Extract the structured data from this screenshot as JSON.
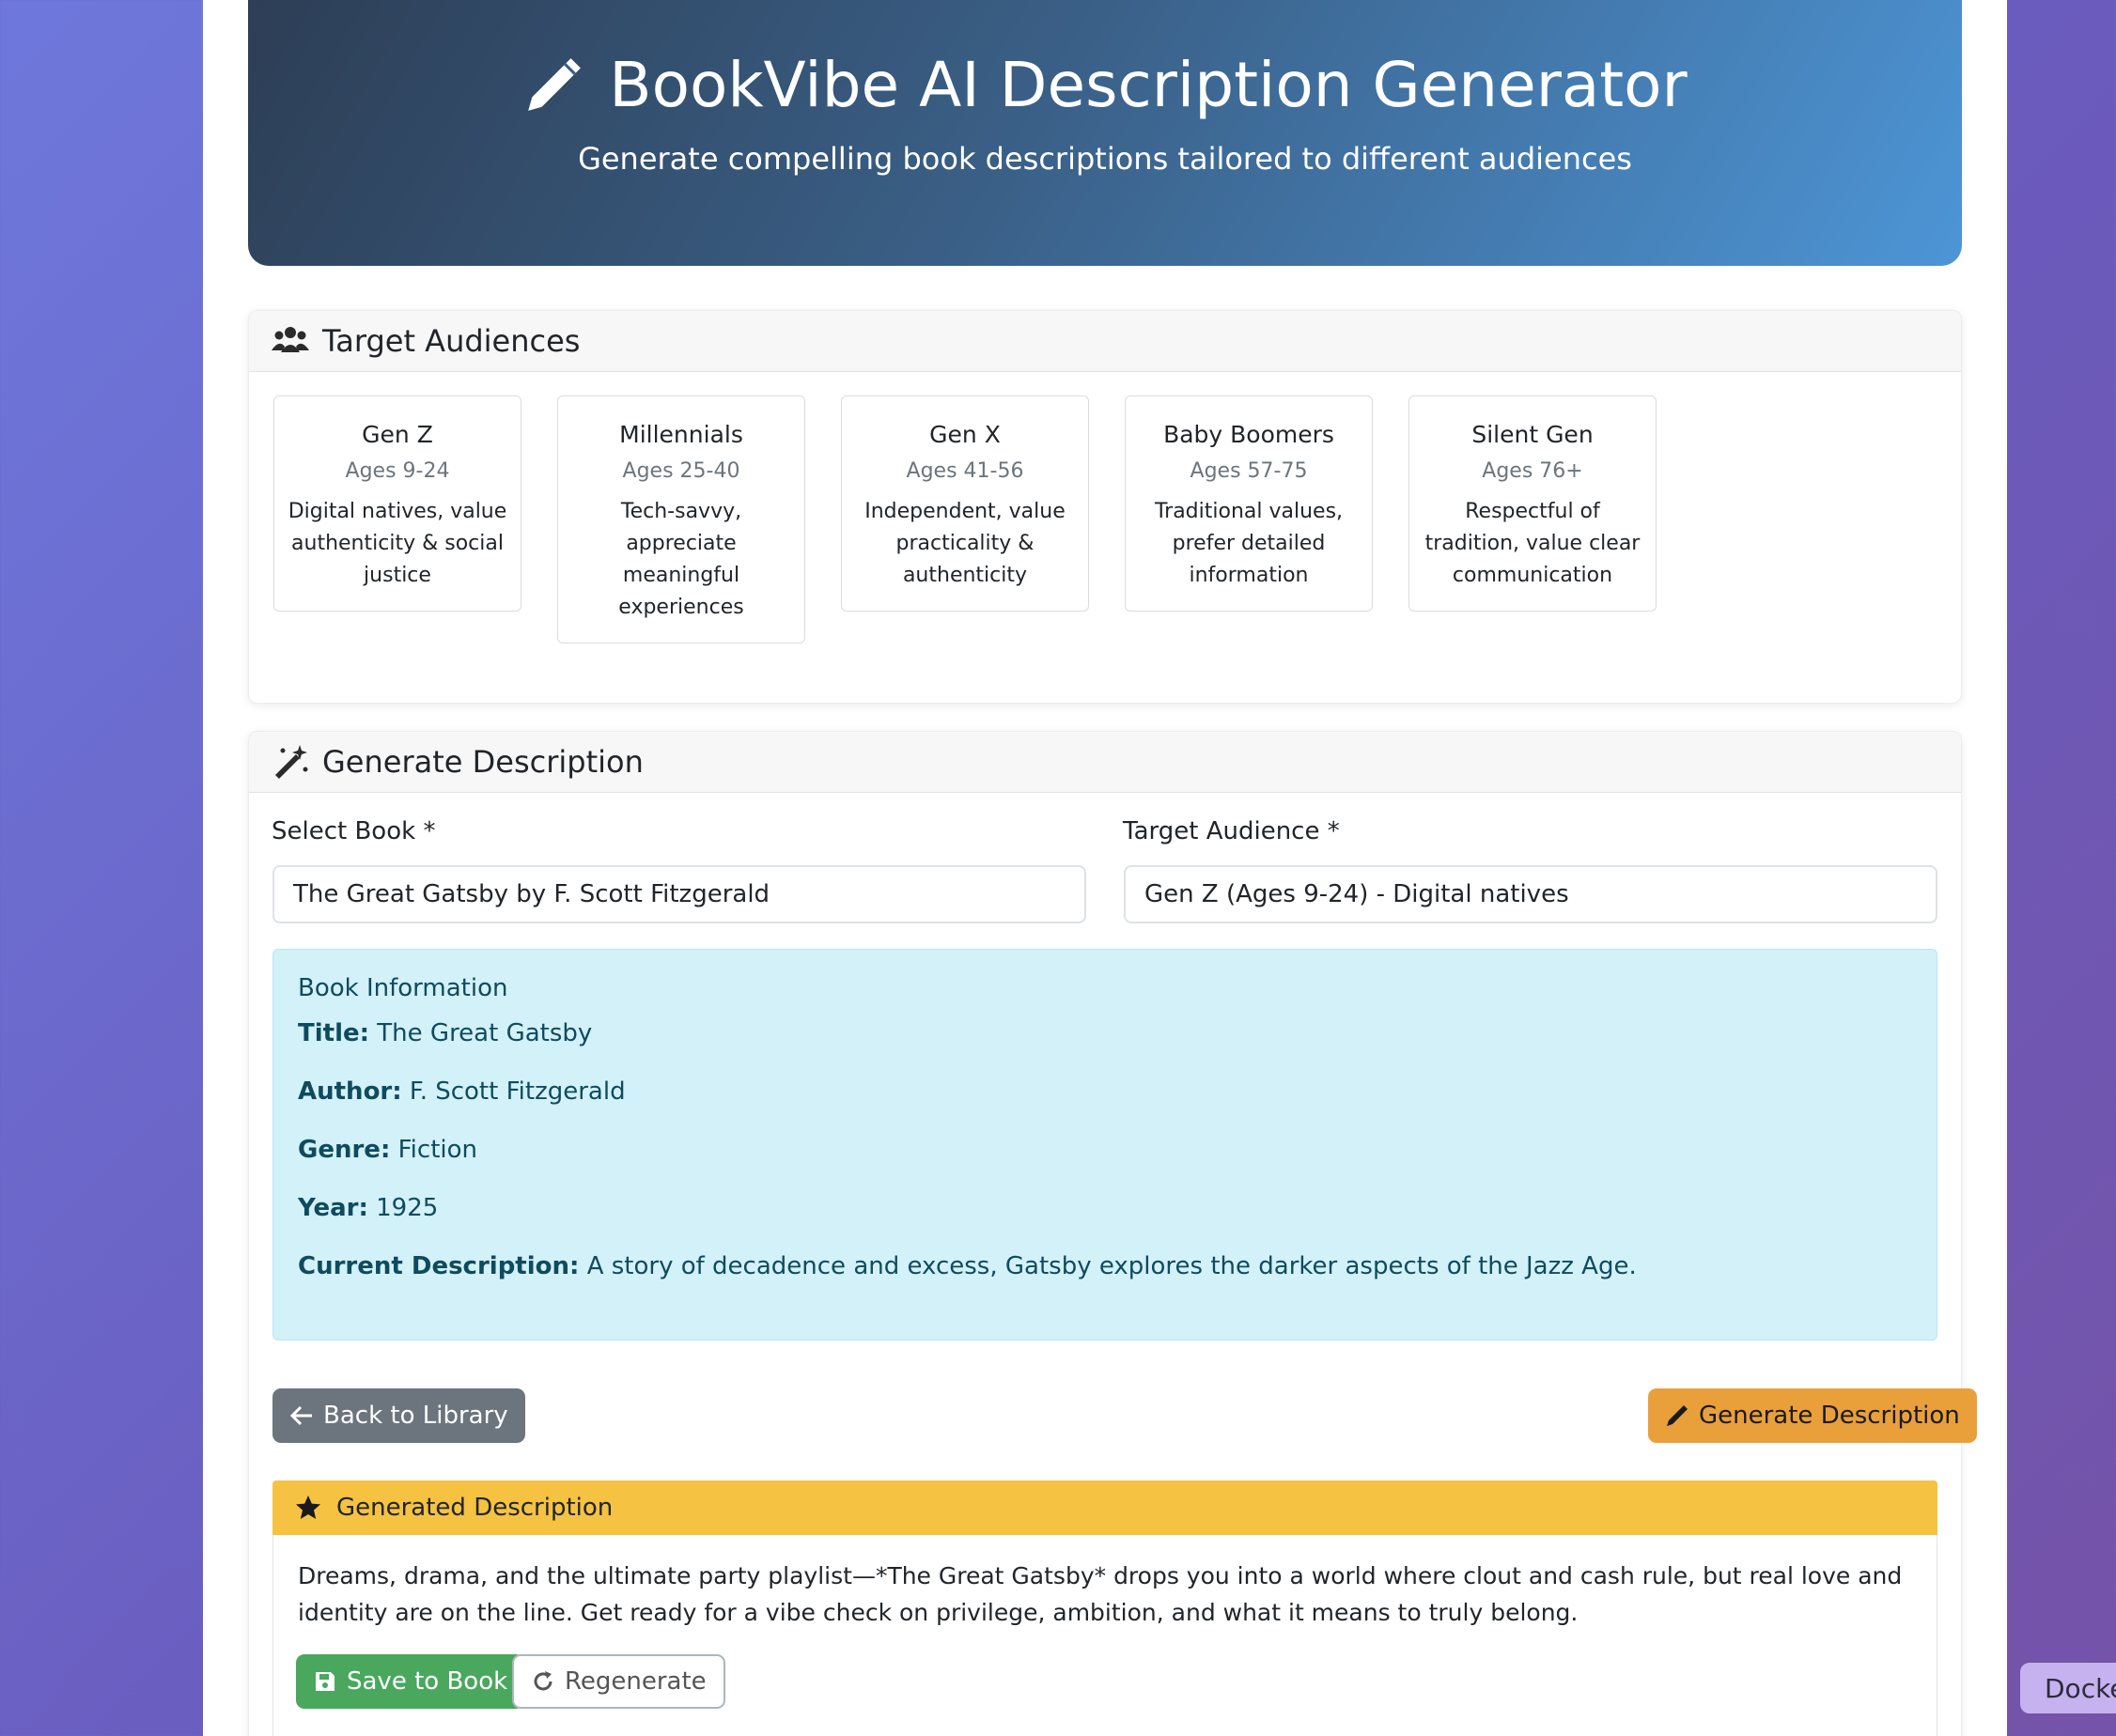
{
  "header": {
    "title": "BookVibe AI Description Generator",
    "subtitle": "Generate compelling book descriptions tailored to different audiences"
  },
  "audiences_section": {
    "title": "Target Audiences",
    "cards": [
      {
        "name": "Gen Z",
        "ages": "Ages 9-24",
        "desc": "Digital natives, value authenticity & social justice"
      },
      {
        "name": "Millennials",
        "ages": "Ages 25-40",
        "desc": "Tech-savvy, appreciate meaningful experiences"
      },
      {
        "name": "Gen X",
        "ages": "Ages 41-56",
        "desc": "Independent, value practicality & authenticity"
      },
      {
        "name": "Baby Boomers",
        "ages": "Ages 57-75",
        "desc": "Traditional values, prefer detailed information"
      },
      {
        "name": "Silent Gen",
        "ages": "Ages 76+",
        "desc": "Respectful of tradition, value clear communication"
      }
    ]
  },
  "generate_section": {
    "title": "Generate Description",
    "book_label": "Select Book *",
    "book_value": "The Great Gatsby by F. Scott Fitzgerald",
    "audience_label": "Target Audience *",
    "audience_value": "Gen Z (Ages 9-24) - Digital natives"
  },
  "book_info": {
    "heading": "Book Information",
    "title_label": "Title:",
    "title": "The Great Gatsby",
    "author_label": "Author:",
    "author": "F. Scott Fitzgerald",
    "genre_label": "Genre:",
    "genre": "Fiction",
    "year_label": "Year:",
    "year": "1925",
    "desc_label": "Current Description:",
    "desc": "A story of decadence and excess, Gatsby explores the darker aspects of the Jazz Age."
  },
  "actions": {
    "back_label": "Back to Library",
    "generate_label": "Generate Description"
  },
  "generated": {
    "heading": "Generated Description",
    "text": "Dreams, drama, and the ultimate party playlist—*The Great Gatsby* drops you into a world where clout and cash rule, but real love and identity are on the line. Get ready for a vibe check on privilege, ambition, and what it means to truly belong.",
    "save_label": "Save to Book",
    "regenerate_label": "Regenerate"
  },
  "docker_tab": {
    "label": "Docker"
  },
  "icons": {
    "header": "pencil-icon",
    "audiences": "users-icon",
    "generate": "magic-wand-icon",
    "back": "arrow-left-icon",
    "generate_button": "pencil-icon",
    "generated": "star-icon",
    "save": "save-icon",
    "regenerate": "refresh-icon"
  }
}
